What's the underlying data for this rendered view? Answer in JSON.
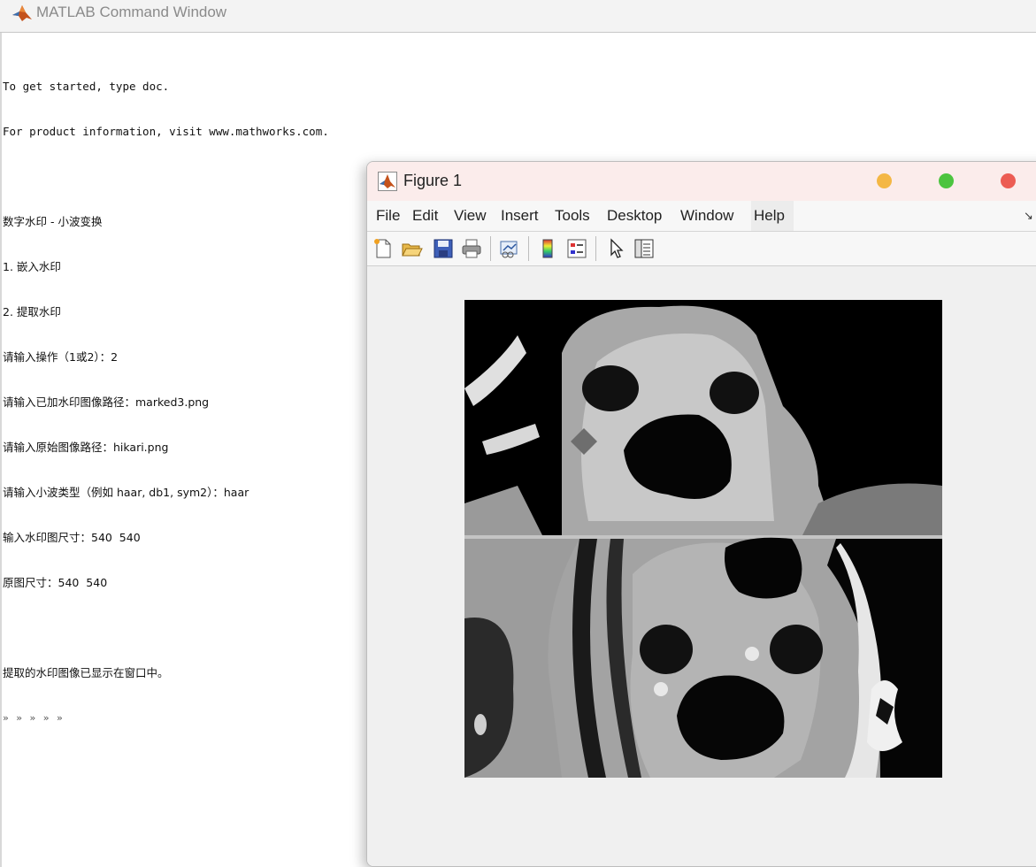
{
  "command_window": {
    "title": "MATLAB Command Window",
    "lines": [
      "To get started, type doc.",
      "For product information, visit www.mathworks.com.",
      "",
      "数字水印 - 小波变换",
      "1. 嵌入水印",
      "2. 提取水印",
      "请输入操作（1或2）：2",
      "请输入已加水印图像路径：marked3.png",
      "请输入原始图像路径：hikari.png",
      "请输入小波类型（例如 haar, db1, sym2）：haar",
      "输入水印图尺寸：540  540",
      "原图尺寸：540  540",
      "",
      "提取的水印图像已显示在窗口中。"
    ],
    "prompt": "» » » » »"
  },
  "figure": {
    "title": "Figure 1",
    "menu": [
      "File",
      "Edit",
      "View",
      "Insert",
      "Tools",
      "Desktop",
      "Window",
      "Help"
    ],
    "toolbar_icons": [
      "new-figure-icon",
      "open-file-icon",
      "save-icon",
      "print-icon",
      "link-plot-icon",
      "colorbar-icon",
      "legend-icon",
      "pointer-icon",
      "property-inspector-icon"
    ],
    "window_controls": {
      "minimize_color": "#f4b744",
      "maximize_color": "#4cc43f",
      "close_color": "#ec5c53"
    },
    "image": {
      "description_name": "extracted-watermark-image"
    }
  }
}
